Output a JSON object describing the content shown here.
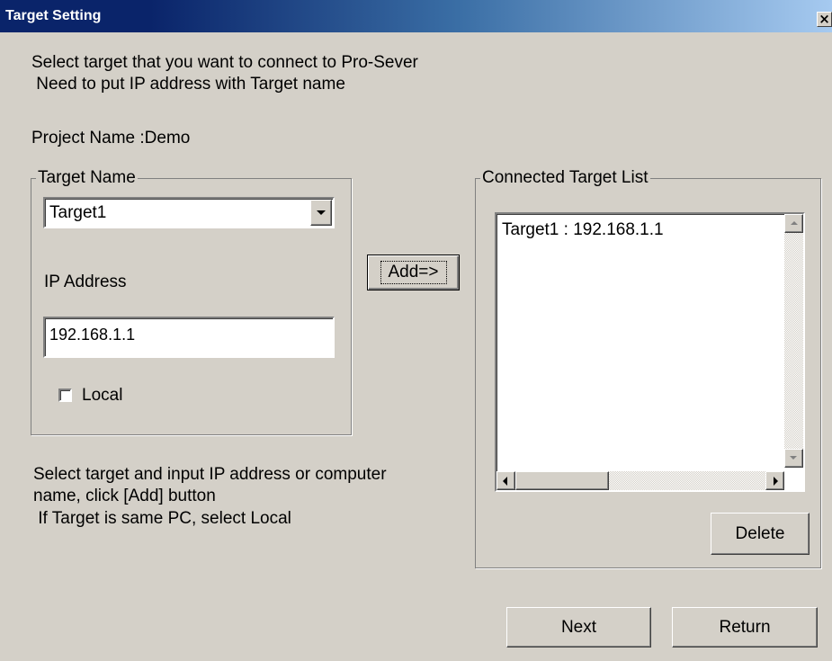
{
  "window": {
    "title": "Target Setting",
    "close_glyph": "×"
  },
  "intro": {
    "line1": "Select target that you want to connect to Pro-Sever",
    "line2": " Need to put IP address with Target name"
  },
  "project": {
    "label": "Project Name :Demo"
  },
  "target_group": {
    "legend": "Target Name",
    "target_select_value": "Target1",
    "ip_label": "IP Address",
    "ip_value": "192.168.1.1",
    "local_label": "Local",
    "local_checked": false
  },
  "add_button": {
    "label": "Add=>"
  },
  "help": {
    "line1": "Select target and input IP address or computer",
    "line2": "name, click [Add] button",
    "line3": " If Target is same PC, select Local"
  },
  "connected_group": {
    "legend": "Connected Target List",
    "items": [
      "Target1 : 192.168.1.1"
    ],
    "delete_label": "Delete"
  },
  "footer": {
    "next_label": "Next",
    "return_label": "Return"
  },
  "icons": {
    "dropdown": "chevron-down-icon",
    "close": "close-icon",
    "scroll_up": "scroll-up-icon",
    "scroll_down": "scroll-down-icon",
    "scroll_left": "scroll-left-icon",
    "scroll_right": "scroll-right-icon"
  },
  "colors": {
    "title_dark": "#0a246a",
    "title_light": "#a6caf0",
    "face": "#d4d0c8"
  }
}
